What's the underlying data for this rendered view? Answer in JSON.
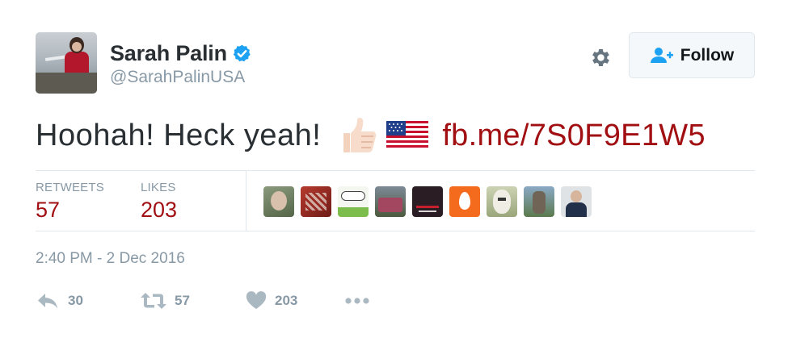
{
  "user": {
    "display_name": "Sarah Palin",
    "handle": "@SarahPalinUSA",
    "verified": true,
    "avatar_icon": "profile-photo"
  },
  "header": {
    "settings_icon": "gear-icon",
    "follow_label": "Follow",
    "follow_icon": "follow-person-plus-icon"
  },
  "tweet": {
    "text": "Hoohah! Heck yeah!",
    "emojis": [
      "thumbs-up-light-skin-tone",
      "us-flag"
    ],
    "link": "fb.me/7S0F9E1W5"
  },
  "stats": {
    "retweets_label": "RETWEETS",
    "retweets_value": "57",
    "likes_label": "LIKES",
    "likes_value": "203",
    "liker_avatar_count": 9
  },
  "timestamp": "2:40 PM - 2 Dec 2016",
  "actions": {
    "reply_count": "30",
    "retweet_count": "57",
    "like_count": "203",
    "more_icon": "more-dots-icon"
  },
  "colors": {
    "link": "#a10f13",
    "muted": "#8899a6",
    "verified": "#1da1f2",
    "follow_icon": "#1da1f2",
    "border": "#e1e8ed"
  }
}
